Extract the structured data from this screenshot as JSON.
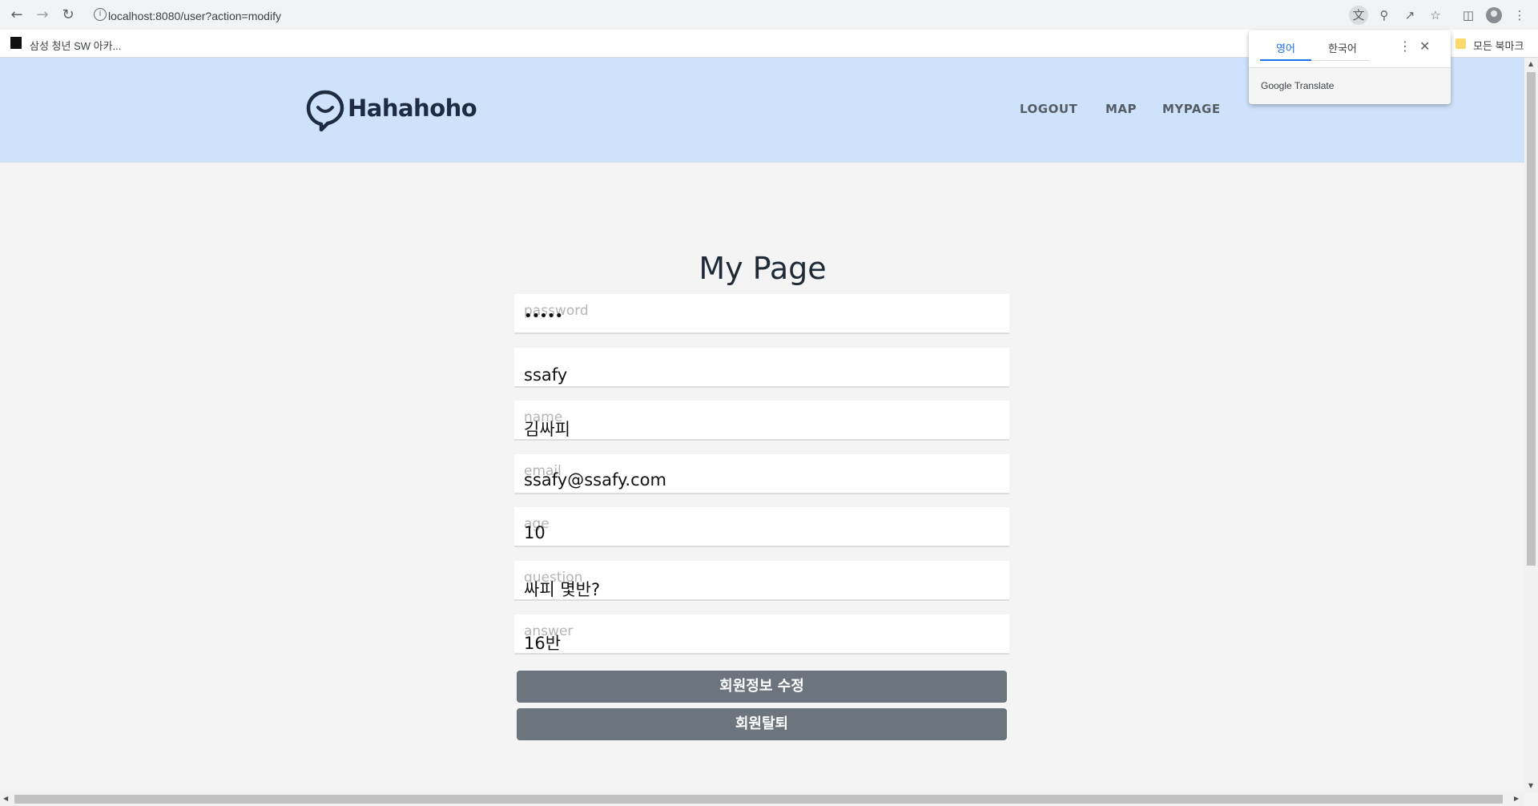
{
  "browser": {
    "url": "localhost:8080/user?action=modify",
    "bookmarks": {
      "left_label": "삼성 청년 SW 아카...",
      "right_label": "모든 북마크"
    },
    "translate_popup": {
      "tab_source": "영어",
      "tab_target": "한국어",
      "brand": "Google Translate"
    }
  },
  "header": {
    "logo_text": "Hahahoho",
    "nav": [
      "LOGOUT",
      "MAP",
      "MYPAGE"
    ]
  },
  "page": {
    "title": "My Page",
    "fields": [
      {
        "placeholder": "password",
        "value": "•••••"
      },
      {
        "placeholder": "",
        "value": "ssafy"
      },
      {
        "placeholder": "name",
        "value": "김싸피"
      },
      {
        "placeholder": "email",
        "value": "ssafy@ssafy.com"
      },
      {
        "placeholder": "age",
        "value": "10"
      },
      {
        "placeholder": "question",
        "value": "싸피 몇반?"
      },
      {
        "placeholder": "answer",
        "value": "16반"
      }
    ],
    "buttons": {
      "modify": "회원정보 수정",
      "withdraw": "회원탈퇴"
    }
  },
  "colors": {
    "header_bg": "#cfe2fc",
    "page_bg": "#f4f4f4",
    "button_bg": "#6c757d",
    "logo": "#1e2b40"
  }
}
